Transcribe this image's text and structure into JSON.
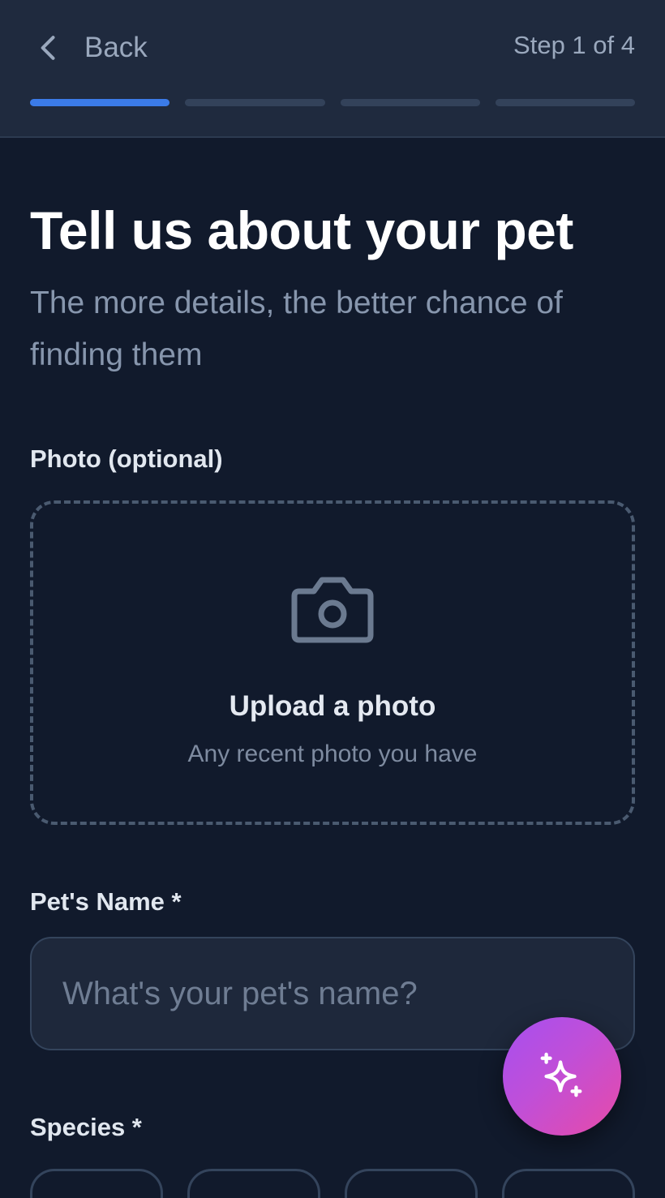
{
  "header": {
    "back_label": "Back",
    "step_label": "Step 1 of 4",
    "progress": {
      "current_step": 1,
      "total_steps": 4
    }
  },
  "content": {
    "title": "Tell us about your pet",
    "subtitle": "The more details, the better chance of finding them"
  },
  "photo": {
    "label": "Photo (optional)",
    "upload_title": "Upload a photo",
    "upload_hint": "Any recent photo you have",
    "icon": "camera-icon"
  },
  "pet_name": {
    "label": "Pet's Name *",
    "placeholder": "What's your pet's name?",
    "value": ""
  },
  "species": {
    "label": "Species *"
  },
  "fab": {
    "icon": "sparkles-icon"
  },
  "colors": {
    "background": "#111a2c",
    "header": "#1f2a3e",
    "accent": "#3b7be8",
    "fab_gradient_start": "#a64ff0",
    "fab_gradient_end": "#e84aa7"
  }
}
